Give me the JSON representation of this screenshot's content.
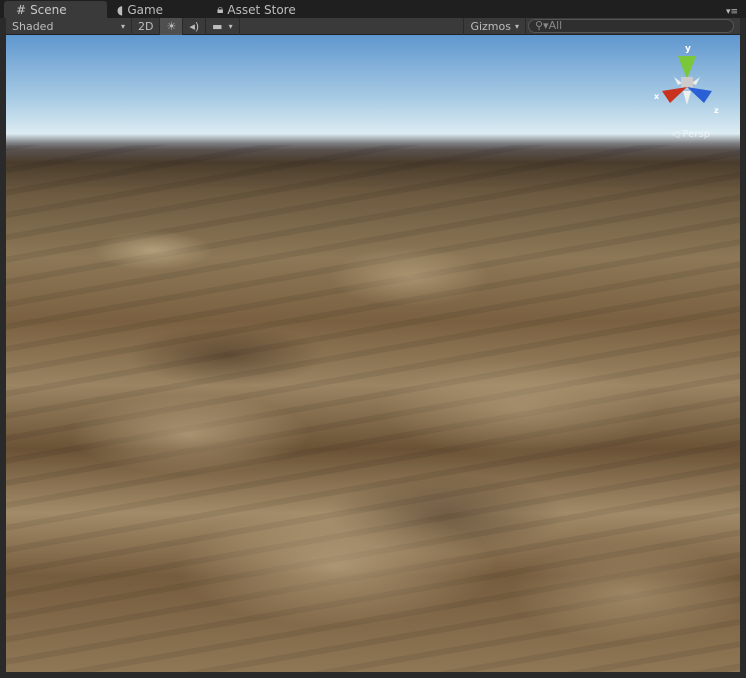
{
  "tabs": [
    {
      "label": "Scene",
      "icon": "grid-icon"
    },
    {
      "label": "Game",
      "icon": "pacman-icon"
    },
    {
      "label": "Asset Store",
      "icon": "lock-icon"
    }
  ],
  "toolbar": {
    "draw_mode": "Shaded",
    "mode_2d": "2D",
    "gizmos": "Gizmos",
    "search_placeholder": "All"
  },
  "gizmo": {
    "y": "y",
    "x": "x",
    "z": "z",
    "projection": "Persp"
  },
  "colors": {
    "x_axis": "#c8321e",
    "y_axis": "#7ac83a",
    "z_axis": "#2a5fd6"
  }
}
